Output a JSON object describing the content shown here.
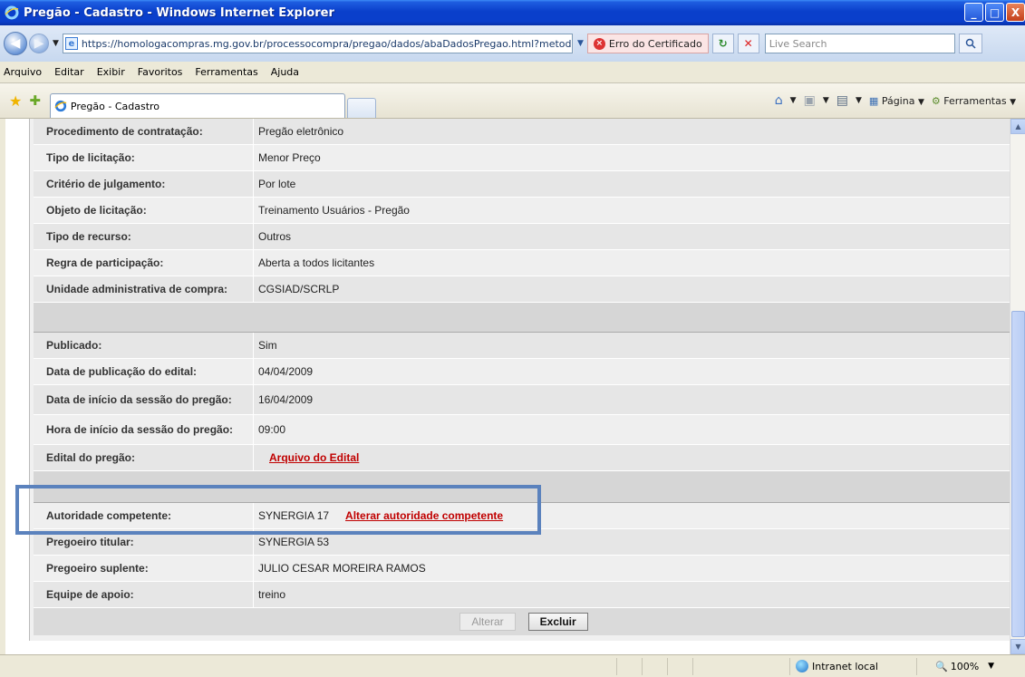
{
  "window": {
    "title": "Pregão - Cadastro - Windows Internet Explorer",
    "min_label": "_",
    "max_label": "□",
    "close_label": "X"
  },
  "address": {
    "url": "https://homologacompras.mg.gov.br/processocompra/pregao/dados/abaDadosPregao.html?metod",
    "cert_error": "Erro do Certificado",
    "search_placeholder": "Live Search"
  },
  "menu": {
    "items": [
      "Arquivo",
      "Editar",
      "Exibir",
      "Favoritos",
      "Ferramentas",
      "Ajuda"
    ]
  },
  "tabs": {
    "active_label": "Pregão - Cadastro"
  },
  "commands": {
    "page_label": "Página",
    "tools_label": "Ferramentas"
  },
  "form": {
    "rows_top": [
      {
        "label": "Procedimento de contratação:",
        "value": "Pregão eletrônico"
      },
      {
        "label": "Tipo de licitação:",
        "value": "Menor Preço"
      },
      {
        "label": "Critério de julgamento:",
        "value": "Por lote"
      },
      {
        "label": "Objeto de licitação:",
        "value": "Treinamento Usuários - Pregão"
      },
      {
        "label": "Tipo de recurso:",
        "value": "Outros"
      },
      {
        "label": "Regra de participação:",
        "value": "Aberta a todos licitantes"
      },
      {
        "label": "Unidade administrativa de compra:",
        "value": "CGSIAD/SCRLP"
      }
    ],
    "rows_pub": [
      {
        "label": "Publicado:",
        "value": "Sim"
      },
      {
        "label": "Data de publicação do edital:",
        "value": "04/04/2009"
      },
      {
        "label": "Data de início da sessão do pregão:",
        "value": "16/04/2009"
      },
      {
        "label": "Hora de início da sessão do pregão:",
        "value": "09:00"
      }
    ],
    "edital": {
      "label": "Edital do pregão:",
      "link": "Arquivo do Edital"
    },
    "autoridade": {
      "label": "Autoridade competente:",
      "value": "SYNERGIA 17",
      "link": "Alterar autoridade competente"
    },
    "rows_bottom": [
      {
        "label": "Pregoeiro titular:",
        "value": "SYNERGIA 53"
      },
      {
        "label": "Pregoeiro suplente:",
        "value": "JULIO CESAR MOREIRA RAMOS"
      },
      {
        "label": "Equipe de apoio:",
        "value": "treino"
      }
    ],
    "buttons": {
      "alterar": "Alterar",
      "excluir": "Excluir"
    }
  },
  "status": {
    "zone": "Intranet local",
    "zoom": "100%"
  },
  "icons": [
    "ie-logo-icon",
    "back-icon",
    "forward-icon",
    "refresh-icon",
    "stop-icon",
    "search-icon",
    "favorites-star-icon",
    "add-favorites-icon",
    "home-icon",
    "rss-icon",
    "print-icon",
    "page-icon",
    "tools-gear-icon",
    "globe-icon",
    "zoom-icon"
  ]
}
